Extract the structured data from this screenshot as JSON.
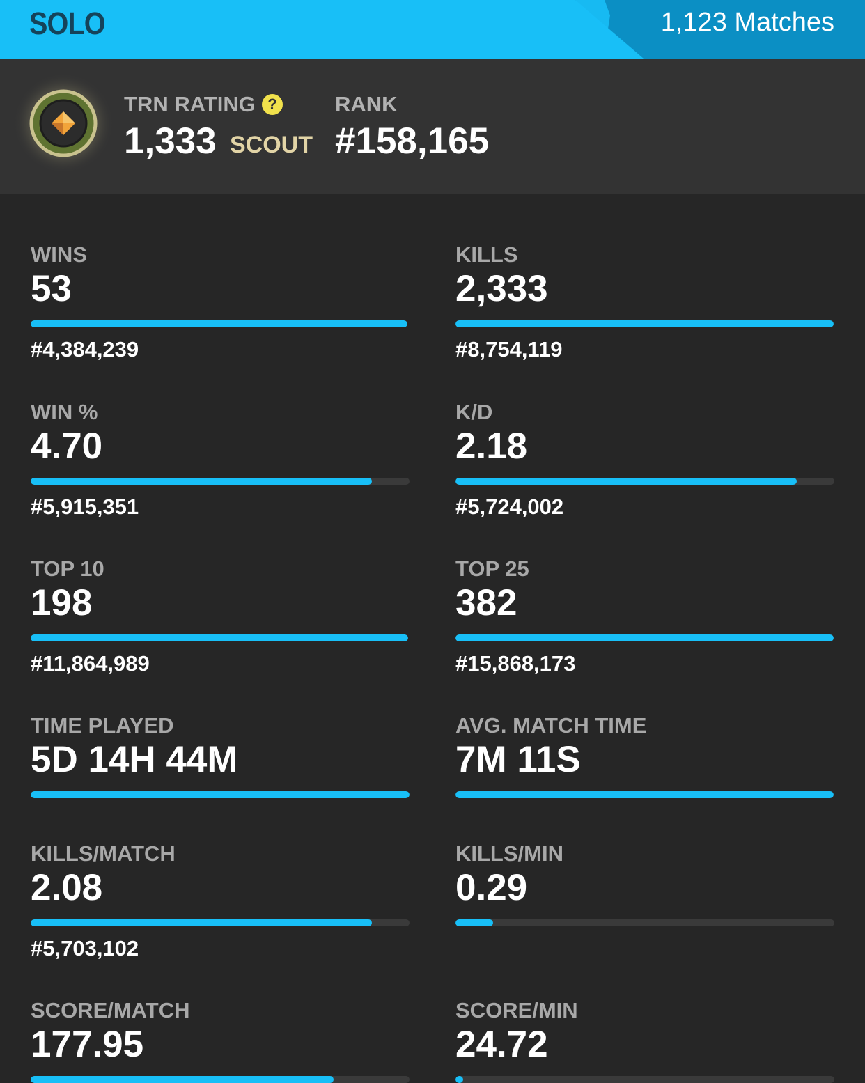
{
  "header": {
    "mode": "SOLO",
    "matches": "1,123 Matches"
  },
  "colors": {
    "accent": "#18bff7",
    "accent_dark": "#0b8fc4",
    "header_text": "#15435a",
    "background": "#262626",
    "panel": "#333333",
    "tier_gold": "#e2d4a6",
    "help_yellow": "#f1e14c"
  },
  "rating": {
    "badge_icon": "rating-badge-icon",
    "trn_label": "TRN RATING",
    "trn_value": "1,333",
    "tier": "SCOUT",
    "help_icon": "question-mark-icon",
    "rank_label": "RANK",
    "rank_value": "#158,165"
  },
  "stats": [
    {
      "label": "WINS",
      "value": "53",
      "rank": "#4,384,239",
      "progress": 1.0
    },
    {
      "label": "KILLS",
      "value": "2,333",
      "rank": "#8,754,119",
      "progress": 1.0
    },
    {
      "label": "WIN %",
      "value": "4.70",
      "rank": "#5,915,351",
      "progress": 0.9
    },
    {
      "label": "K/D",
      "value": "2.18",
      "rank": "#5,724,002",
      "progress": 0.9
    },
    {
      "label": "TOP 10",
      "value": "198",
      "rank": "#11,864,989",
      "progress": 1.0
    },
    {
      "label": "TOP 25",
      "value": "382",
      "rank": "#15,868,173",
      "progress": 1.0
    },
    {
      "label": "TIME PLAYED",
      "value": "5D 14H 44M",
      "rank": "",
      "progress": 1.0
    },
    {
      "label": "AVG. MATCH TIME",
      "value": "7M 11S",
      "rank": "",
      "progress": 1.0
    },
    {
      "label": "KILLS/MATCH",
      "value": "2.08",
      "rank": "#5,703,102",
      "progress": 0.9
    },
    {
      "label": "KILLS/MIN",
      "value": "0.29",
      "rank": "",
      "progress": 0.1
    },
    {
      "label": "SCORE/MATCH",
      "value": "177.95",
      "rank": "",
      "progress": 0.8
    },
    {
      "label": "SCORE/MIN",
      "value": "24.72",
      "rank": "",
      "progress": 0.02
    }
  ]
}
